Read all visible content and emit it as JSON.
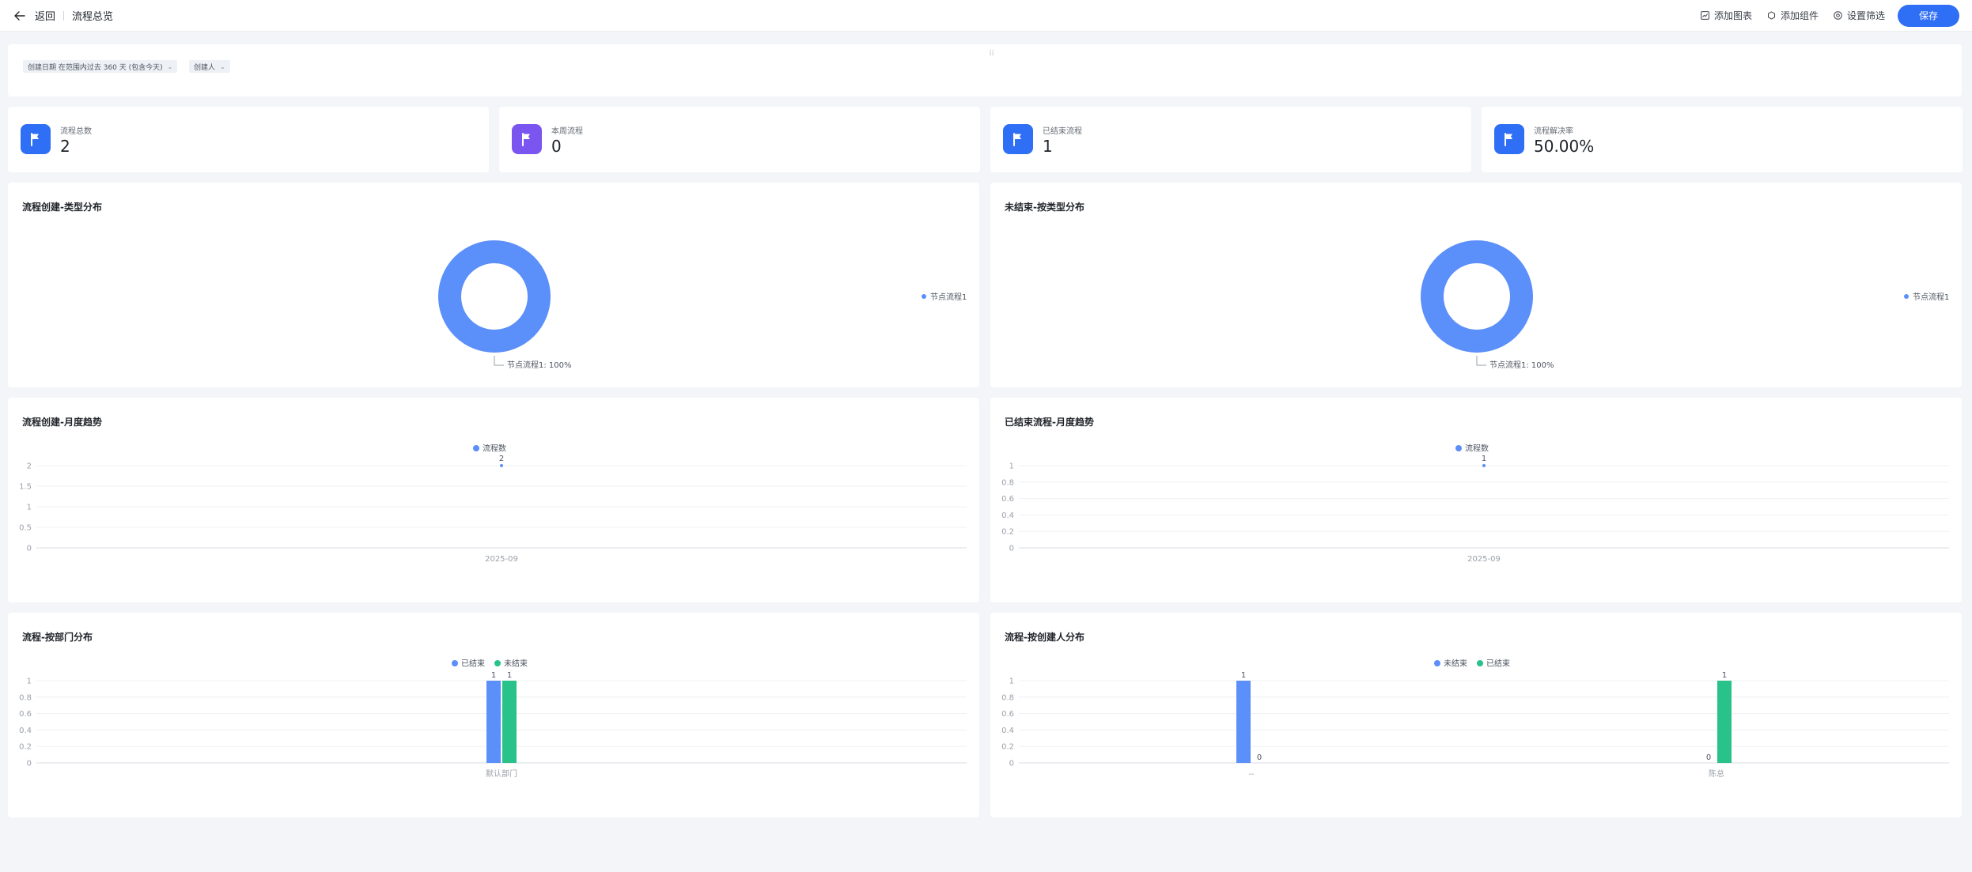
{
  "header": {
    "back_label": "返回",
    "page_title": "流程总览",
    "actions": {
      "add_chart": "添加图表",
      "add_component": "添加组件",
      "set_filter": "设置筛选"
    },
    "save_label": "保存"
  },
  "filters": {
    "created_date": "创建日期 在范围内过去 360 天 (包含今天)",
    "creator": "创建人"
  },
  "stats": [
    {
      "label": "流程总数",
      "value": "2",
      "color": "#2f6ff5"
    },
    {
      "label": "本周流程",
      "value": "0",
      "color": "#7a55f0"
    },
    {
      "label": "已结束流程",
      "value": "1",
      "color": "#2f6ff5"
    },
    {
      "label": "流程解决率",
      "value": "50.00%",
      "color": "#2f6ff5"
    }
  ],
  "colors": {
    "blue": "#5b8ff9",
    "green": "#28c28a",
    "axis": "#d9dde3",
    "grid": "#eef0f3",
    "tick": "#9aa0a8"
  },
  "chart_data": [
    {
      "id": "pie1",
      "type": "pie",
      "title": "流程创建-类型分布",
      "slices": [
        {
          "name": "节点流程1",
          "value": 100
        }
      ],
      "slice_label": "节点流程1: 100%",
      "legend": [
        "节点流程1"
      ],
      "legend_position": "right"
    },
    {
      "id": "pie2",
      "type": "pie",
      "title": "未结束-按类型分布",
      "slices": [
        {
          "name": "节点流程1",
          "value": 100
        }
      ],
      "slice_label": "节点流程1: 100%",
      "legend": [
        "节点流程1"
      ],
      "legend_position": "right"
    },
    {
      "id": "line1",
      "type": "line",
      "title": "流程创建-月度趋势",
      "x": [
        "2025-09"
      ],
      "series": [
        {
          "name": "流程数",
          "values": [
            2
          ]
        }
      ],
      "yticks": [
        "2",
        "1.5",
        "1",
        "0.5",
        "0"
      ],
      "ylim": [
        0,
        2
      ],
      "legend_position": "top"
    },
    {
      "id": "line2",
      "type": "line",
      "title": "已结束流程-月度趋势",
      "x": [
        "2025-09"
      ],
      "series": [
        {
          "name": "流程数",
          "values": [
            1
          ]
        }
      ],
      "yticks": [
        "1",
        "0.8",
        "0.6",
        "0.4",
        "0.2",
        "0"
      ],
      "ylim": [
        0,
        1
      ],
      "legend_position": "top"
    },
    {
      "id": "bar1",
      "type": "bar",
      "title": "流程-按部门分布",
      "categories": [
        "默认部门"
      ],
      "series": [
        {
          "name": "已结束",
          "values": [
            1
          ],
          "color": "#5b8ff9"
        },
        {
          "name": "未结束",
          "values": [
            1
          ],
          "color": "#28c28a"
        }
      ],
      "yticks": [
        "1",
        "0.8",
        "0.6",
        "0.4",
        "0.2",
        "0"
      ],
      "ylim": [
        0,
        1
      ],
      "legend_position": "top"
    },
    {
      "id": "bar2",
      "type": "bar",
      "title": "流程-按创建人分布",
      "categories": [
        "--",
        "陈总"
      ],
      "series": [
        {
          "name": "未结束",
          "values": [
            1,
            0
          ],
          "color": "#5b8ff9"
        },
        {
          "name": "已结束",
          "values": [
            0,
            1
          ],
          "color": "#28c28a"
        }
      ],
      "yticks": [
        "1",
        "0.8",
        "0.6",
        "0.4",
        "0.2",
        "0"
      ],
      "ylim": [
        0,
        1
      ],
      "legend_position": "top"
    }
  ]
}
